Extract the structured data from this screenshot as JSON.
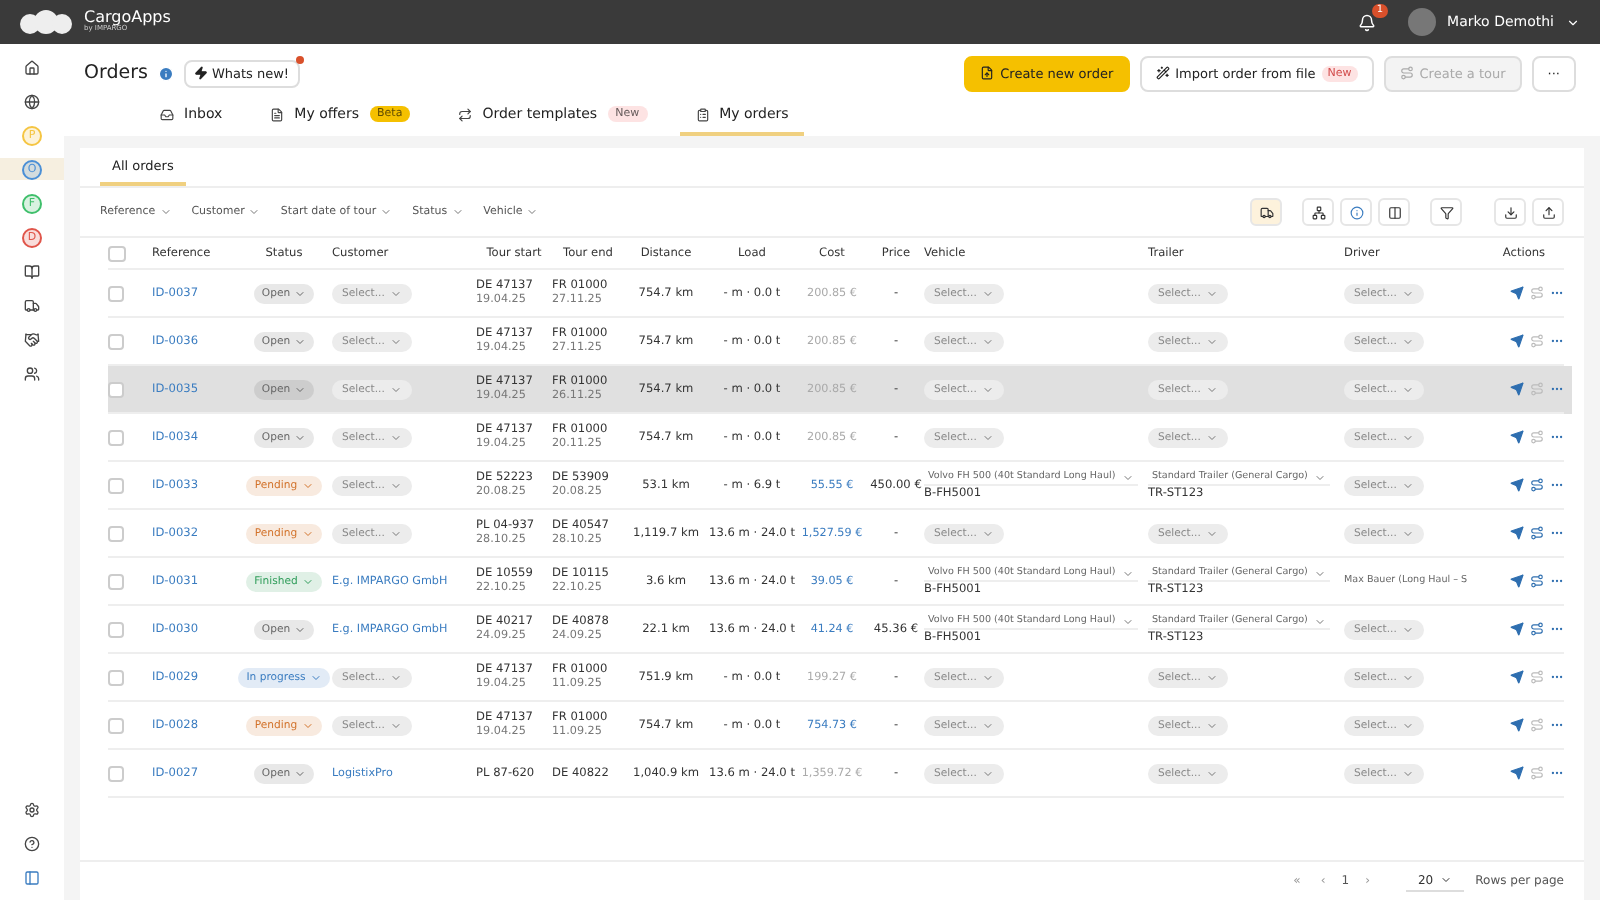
{
  "topbar": {
    "brand": "CargoApps",
    "brand_sub": "by IMPARGO",
    "notifications": "1",
    "user": "Marko Demothi"
  },
  "sidebar": {
    "items": [
      {
        "kind": "icon",
        "selected": false
      },
      {
        "kind": "icon",
        "selected": false
      },
      {
        "kind": "letter",
        "label": "P",
        "color": "#f5c542",
        "selected": false
      },
      {
        "kind": "letter",
        "label": "O",
        "color": "#4a8fd6",
        "selected": true
      },
      {
        "kind": "letter",
        "label": "F",
        "color": "#3fbf6b",
        "selected": false
      },
      {
        "kind": "letter",
        "label": "D",
        "color": "#e0554a",
        "selected": false
      },
      {
        "kind": "icon",
        "selected": false
      },
      {
        "kind": "icon",
        "selected": false
      },
      {
        "kind": "icon",
        "selected": false
      },
      {
        "kind": "icon",
        "selected": false
      }
    ]
  },
  "header": {
    "title": "Orders",
    "whats_new": "Whats new!",
    "whats_new_dot": true,
    "buttons": [
      {
        "kind": "primary",
        "label": "Create new order",
        "disabled": false
      },
      {
        "kind": "outline",
        "label": "Import order from file",
        "badge": "New",
        "disabled": false
      },
      {
        "kind": "outline",
        "label": "Create a tour",
        "disabled": true
      },
      {
        "kind": "more",
        "label": "···",
        "disabled": false
      }
    ]
  },
  "tabs": [
    {
      "label": "Inbox",
      "selected": false
    },
    {
      "label": "My offers",
      "badge": {
        "text": "Beta",
        "color": "#f5c000"
      },
      "selected": false
    },
    {
      "label": "Order templates",
      "badge": {
        "text": "New",
        "color": "#fde3e3"
      },
      "selected": false
    },
    {
      "label": "My orders",
      "selected": true
    }
  ],
  "subtabs": [
    {
      "label": "All orders",
      "selected": true
    }
  ],
  "filters": [
    "Reference",
    "Customer",
    "Start date of tour",
    "Status",
    "Vehicle"
  ],
  "view_tools": [
    {
      "selected": true
    },
    {
      "selected": false
    },
    {
      "selected": false
    },
    {
      "selected": false
    },
    {
      "selected": false
    },
    {
      "selected": false
    },
    {
      "selected": false
    }
  ],
  "table": {
    "columns": [
      "Reference",
      "Status",
      "Customer",
      "Tour start",
      "Tour end",
      "Distance",
      "Load",
      "Cost",
      "Price",
      "Vehicle",
      "Trailer",
      "Driver",
      "Actions"
    ],
    "all_checked": false,
    "rows": [
      {
        "checked": false,
        "reference": "ID-0037",
        "status": "Open",
        "color": "#666666",
        "customer": {
          "kind": "select",
          "text": "Select..."
        },
        "start": [
          "DE 47137",
          "19.04.25"
        ],
        "end": [
          "FR 01000",
          "27.11.25"
        ],
        "distance": "754.7 km",
        "load": "- m · 0.0 t",
        "cost": "200.85 €",
        "cost_linked": false,
        "price": "-",
        "vehicle": {
          "kind": "select",
          "text": "Select..."
        },
        "trailer": {
          "kind": "select",
          "text": "Select..."
        },
        "driver": {
          "kind": "select",
          "text": "Select..."
        },
        "assign_active": false,
        "highlighted": false
      },
      {
        "checked": false,
        "reference": "ID-0036",
        "status": "Open",
        "color": "#666666",
        "customer": {
          "kind": "select",
          "text": "Select..."
        },
        "start": [
          "DE 47137",
          "19.04.25"
        ],
        "end": [
          "FR 01000",
          "27.11.25"
        ],
        "distance": "754.7 km",
        "load": "- m · 0.0 t",
        "cost": "200.85 €",
        "cost_linked": false,
        "price": "-",
        "vehicle": {
          "kind": "select",
          "text": "Select..."
        },
        "trailer": {
          "kind": "select",
          "text": "Select..."
        },
        "driver": {
          "kind": "select",
          "text": "Select..."
        },
        "assign_active": false,
        "highlighted": false
      },
      {
        "checked": false,
        "reference": "ID-0035",
        "status": "Open",
        "color": "#666666",
        "customer": {
          "kind": "select",
          "text": "Select..."
        },
        "start": [
          "DE 47137",
          "19.04.25"
        ],
        "end": [
          "FR 01000",
          "26.11.25"
        ],
        "distance": "754.7 km",
        "load": "- m · 0.0 t",
        "cost": "200.85 €",
        "cost_linked": false,
        "price": "-",
        "vehicle": {
          "kind": "select",
          "text": "Select..."
        },
        "trailer": {
          "kind": "select",
          "text": "Select..."
        },
        "driver": {
          "kind": "select",
          "text": "Select..."
        },
        "assign_active": false,
        "highlighted": true
      },
      {
        "checked": false,
        "reference": "ID-0034",
        "status": "Open",
        "color": "#666666",
        "customer": {
          "kind": "select",
          "text": "Select..."
        },
        "start": [
          "DE 47137",
          "19.04.25"
        ],
        "end": [
          "FR 01000",
          "20.11.25"
        ],
        "distance": "754.7 km",
        "load": "- m · 0.0 t",
        "cost": "200.85 €",
        "cost_linked": false,
        "price": "-",
        "vehicle": {
          "kind": "select",
          "text": "Select..."
        },
        "trailer": {
          "kind": "select",
          "text": "Select..."
        },
        "driver": {
          "kind": "select",
          "text": "Select..."
        },
        "assign_active": false,
        "highlighted": false
      },
      {
        "checked": false,
        "reference": "ID-0033",
        "status": "Pending",
        "color": "#d2722a",
        "customer": {
          "kind": "select",
          "text": "Select..."
        },
        "start": [
          "DE 52223",
          "20.08.25"
        ],
        "end": [
          "DE 53909",
          "20.08.25"
        ],
        "distance": "53.1 km",
        "load": "- m · 6.9 t",
        "cost": "55.55 €",
        "cost_linked": true,
        "price": "450.00 €",
        "vehicle": {
          "kind": "value",
          "text": "Volvo FH 500 (40t Standard Long Haul)",
          "sub": "B-FH5001"
        },
        "trailer": {
          "kind": "value",
          "text": "Standard Trailer (General Cargo)",
          "sub": "TR-ST123"
        },
        "driver": {
          "kind": "select",
          "text": "Select..."
        },
        "assign_active": true,
        "highlighted": false
      },
      {
        "checked": false,
        "reference": "ID-0032",
        "status": "Pending",
        "color": "#d2722a",
        "customer": {
          "kind": "select",
          "text": "Select..."
        },
        "start": [
          "PL 04-937",
          "28.10.25"
        ],
        "end": [
          "DE 40547",
          "28.10.25"
        ],
        "distance": "1,119.7 km",
        "load": "13.6 m · 24.0 t",
        "cost": "1,527.59 €",
        "cost_linked": true,
        "price": "-",
        "vehicle": {
          "kind": "select",
          "text": "Select..."
        },
        "trailer": {
          "kind": "select",
          "text": "Select..."
        },
        "driver": {
          "kind": "select",
          "text": "Select..."
        },
        "assign_active": true,
        "highlighted": false
      },
      {
        "checked": false,
        "reference": "ID-0031",
        "status": "Finished",
        "color": "#2f9d5a",
        "customer": {
          "kind": "link",
          "text": "E.g. IMPARGO GmbH"
        },
        "start": [
          "DE 10559",
          "22.10.25"
        ],
        "end": [
          "DE 10115",
          "22.10.25"
        ],
        "distance": "3.6 km",
        "load": "13.6 m · 24.0 t",
        "cost": "39.05 €",
        "cost_linked": true,
        "price": "-",
        "vehicle": {
          "kind": "value",
          "text": "Volvo FH 500 (40t Standard Long Haul)",
          "sub": "B-FH5001"
        },
        "trailer": {
          "kind": "value",
          "text": "Standard Trailer (General Cargo)",
          "sub": "TR-ST123"
        },
        "driver": {
          "kind": "text",
          "text": "Max Bauer (Long Haul – S"
        },
        "assign_active": true,
        "highlighted": false
      },
      {
        "checked": false,
        "reference": "ID-0030",
        "status": "Open",
        "color": "#666666",
        "customer": {
          "kind": "link",
          "text": "E.g. IMPARGO GmbH"
        },
        "start": [
          "DE 40217",
          "24.09.25"
        ],
        "end": [
          "DE 40878",
          "24.09.25"
        ],
        "distance": "22.1 km",
        "load": "13.6 m · 24.0 t",
        "cost": "41.24 €",
        "cost_linked": true,
        "price": "45.36 €",
        "vehicle": {
          "kind": "value",
          "text": "Volvo FH 500 (40t Standard Long Haul)",
          "sub": "B-FH5001"
        },
        "trailer": {
          "kind": "value",
          "text": "Standard Trailer (General Cargo)",
          "sub": "TR-ST123"
        },
        "driver": {
          "kind": "select",
          "text": "Select..."
        },
        "assign_active": true,
        "highlighted": false
      },
      {
        "checked": false,
        "reference": "ID-0029",
        "status": "In progress",
        "color": "#3a7cc0",
        "customer": {
          "kind": "select",
          "text": "Select..."
        },
        "start": [
          "DE 47137",
          "19.04.25"
        ],
        "end": [
          "FR 01000",
          "11.09.25"
        ],
        "distance": "751.9 km",
        "load": "- m · 0.0 t",
        "cost": "199.27 €",
        "cost_linked": false,
        "price": "-",
        "vehicle": {
          "kind": "select",
          "text": "Select..."
        },
        "trailer": {
          "kind": "select",
          "text": "Select..."
        },
        "driver": {
          "kind": "select",
          "text": "Select..."
        },
        "assign_active": false,
        "highlighted": false
      },
      {
        "checked": false,
        "reference": "ID-0028",
        "status": "Pending",
        "color": "#d2722a",
        "customer": {
          "kind": "select",
          "text": "Select..."
        },
        "start": [
          "DE 47137",
          "19.04.25"
        ],
        "end": [
          "FR 01000",
          "11.09.25"
        ],
        "distance": "754.7 km",
        "load": "- m · 0.0 t",
        "cost": "754.73 €",
        "cost_linked": true,
        "price": "-",
        "vehicle": {
          "kind": "select",
          "text": "Select..."
        },
        "trailer": {
          "kind": "select",
          "text": "Select..."
        },
        "driver": {
          "kind": "select",
          "text": "Select..."
        },
        "assign_active": false,
        "highlighted": false
      },
      {
        "checked": false,
        "reference": "ID-0027",
        "status": "Open",
        "color": "#666666",
        "customer": {
          "kind": "link",
          "text": "LogistixPro"
        },
        "start": [
          "PL 87-620"
        ],
        "end": [
          "DE 40822"
        ],
        "distance": "1,040.9 km",
        "load": "13.6 m · 24.0 t",
        "cost": "1,359.72 €",
        "cost_linked": false,
        "price": "-",
        "vehicle": {
          "kind": "select",
          "text": "Select..."
        },
        "trailer": {
          "kind": "select",
          "text": "Select..."
        },
        "driver": {
          "kind": "select",
          "text": "Select..."
        },
        "assign_active": false,
        "highlighted": false
      }
    ]
  },
  "pagination": {
    "page": "1",
    "first": "«",
    "prev": "‹",
    "next": "›",
    "per_page": "20",
    "per_page_label": "Rows per page"
  }
}
